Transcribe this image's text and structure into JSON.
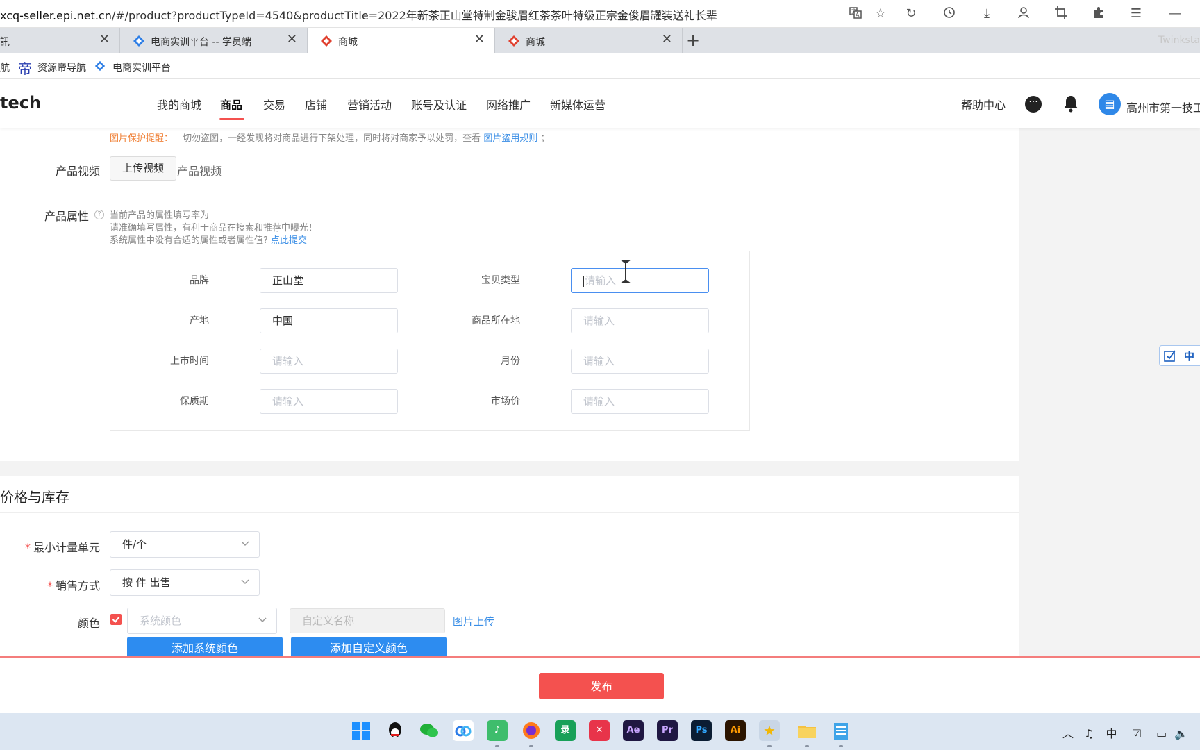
{
  "browser": {
    "url_host": "xcq-seller.epi.net.cn",
    "url_path": "/#/product?productTypeId=4540&productTitle=2022年新茶正山堂特制金骏眉红茶茶叶特级正宗金俊眉罐装送礼长辈",
    "tabs": [
      {
        "title": "訊",
        "active": false
      },
      {
        "title": "电商实训平台 -- 学员端",
        "active": false
      },
      {
        "title": "商城",
        "active": true
      },
      {
        "title": "商城",
        "active": false
      }
    ],
    "tab_right_text": "Twinksta",
    "new_tab_icon": "plus-icon",
    "bookmarks": [
      "航",
      "资源帝导航",
      "电商实训平台"
    ],
    "bookmark_icon_label": "帝"
  },
  "site": {
    "logo_text": "tech",
    "nav": [
      "我的商城",
      "商品",
      "交易",
      "店铺",
      "营销活动",
      "账号及认证",
      "网络推广",
      "新媒体运营"
    ],
    "active_nav_index": 1,
    "help": "帮助中心",
    "shop_name": "高州市第一技工",
    "accent_color": "#f4514f"
  },
  "form": {
    "image_protect": {
      "label": "图片保护提醒：",
      "text": "切勿盗图，一经发现将对商品进行下架处理，同时将对商家予以处罚，查看",
      "link": "图片盗用规则",
      "suffix": "；"
    },
    "video": {
      "label": "产品视频",
      "button": "上传视频",
      "hint": "产品视频"
    },
    "attributes": {
      "label": "产品属性",
      "hint_line1": "当前产品的属性填写率为",
      "hint_line2": "请准确填写属性，有利于商品在搜索和推荐中曝光！",
      "hint_line3": "系统属性中没有合适的属性或者属性值?",
      "hint_link": "点此提交",
      "fields": [
        {
          "label": "品牌",
          "value": "正山堂",
          "placeholder": "请输入"
        },
        {
          "label": "宝贝类型",
          "value": "",
          "placeholder": "请输入"
        },
        {
          "label": "产地",
          "value": "中国",
          "placeholder": "请输入"
        },
        {
          "label": "商品所在地",
          "value": "",
          "placeholder": "请输入"
        },
        {
          "label": "上市时间",
          "value": "",
          "placeholder": "请输入"
        },
        {
          "label": "月份",
          "value": "",
          "placeholder": "请输入"
        },
        {
          "label": "保质期",
          "value": "",
          "placeholder": "请输入"
        },
        {
          "label": "市场价",
          "value": "",
          "placeholder": "请输入"
        }
      ]
    },
    "price_section": {
      "title": "价格与库存",
      "min_unit_label": "最小计量单元",
      "min_unit_value": "件/个",
      "sale_mode_label": "销售方式",
      "sale_mode_value": "按 件 出售",
      "color_label": "颜色",
      "system_color_placeholder": "系统颜色",
      "custom_name_placeholder": "自定义名称",
      "image_upload_link": "图片上传",
      "add_system_color": "添加系统颜色",
      "add_custom_color": "添加自定义颜色"
    },
    "publish": "发布"
  },
  "ime_widget": {
    "text": "中"
  },
  "taskbar": {
    "apps": [
      "windows-start-icon",
      "qq-icon",
      "wechat-icon",
      "baidu-netdisk-icon",
      "music-icon",
      "firefox-icon",
      "recorder-icon",
      "xmind-icon",
      "after-effects-icon",
      "premiere-icon",
      "photoshop-icon",
      "illustrator-icon",
      "star-app-icon",
      "file-explorer-icon",
      "notepad-icon"
    ],
    "app_labels": {
      "recorder": "录",
      "ae": "Ae",
      "pr": "Pr",
      "ps": "Ps",
      "ai": "Ai"
    },
    "tray_ime": "中"
  }
}
